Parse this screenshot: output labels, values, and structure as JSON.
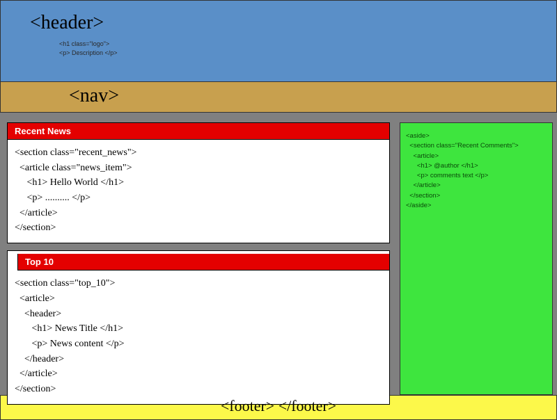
{
  "header": {
    "title": "<header>",
    "sub_line1": "<h1 class=\"logo\">",
    "sub_line2": "<p> Description </p>"
  },
  "nav": {
    "title": "<nav>"
  },
  "cards": {
    "recent_news": {
      "header": "Recent News",
      "body": "<section class=\"recent_news\">\n  <article class=\"news_item\">\n     <h1> Hello World </h1>\n     <p> .......... </p>\n  </article>\n</section>"
    },
    "top10": {
      "header": "Top 10",
      "body": "<section class=\"top_10\">\n  <article>\n    <header>\n       <h1> News Title </h1>\n       <p> News content </p>\n    </header>\n  </article>\n</section>"
    }
  },
  "aside": {
    "body": "<aside>\n  <section class=\"Recent Comments\">\n    <article>\n      <h1> @author </h1>\n      <p> comments text </p>\n    </article>\n  </section>\n</aside>"
  },
  "footer": {
    "label": "<footer> </footer>"
  }
}
